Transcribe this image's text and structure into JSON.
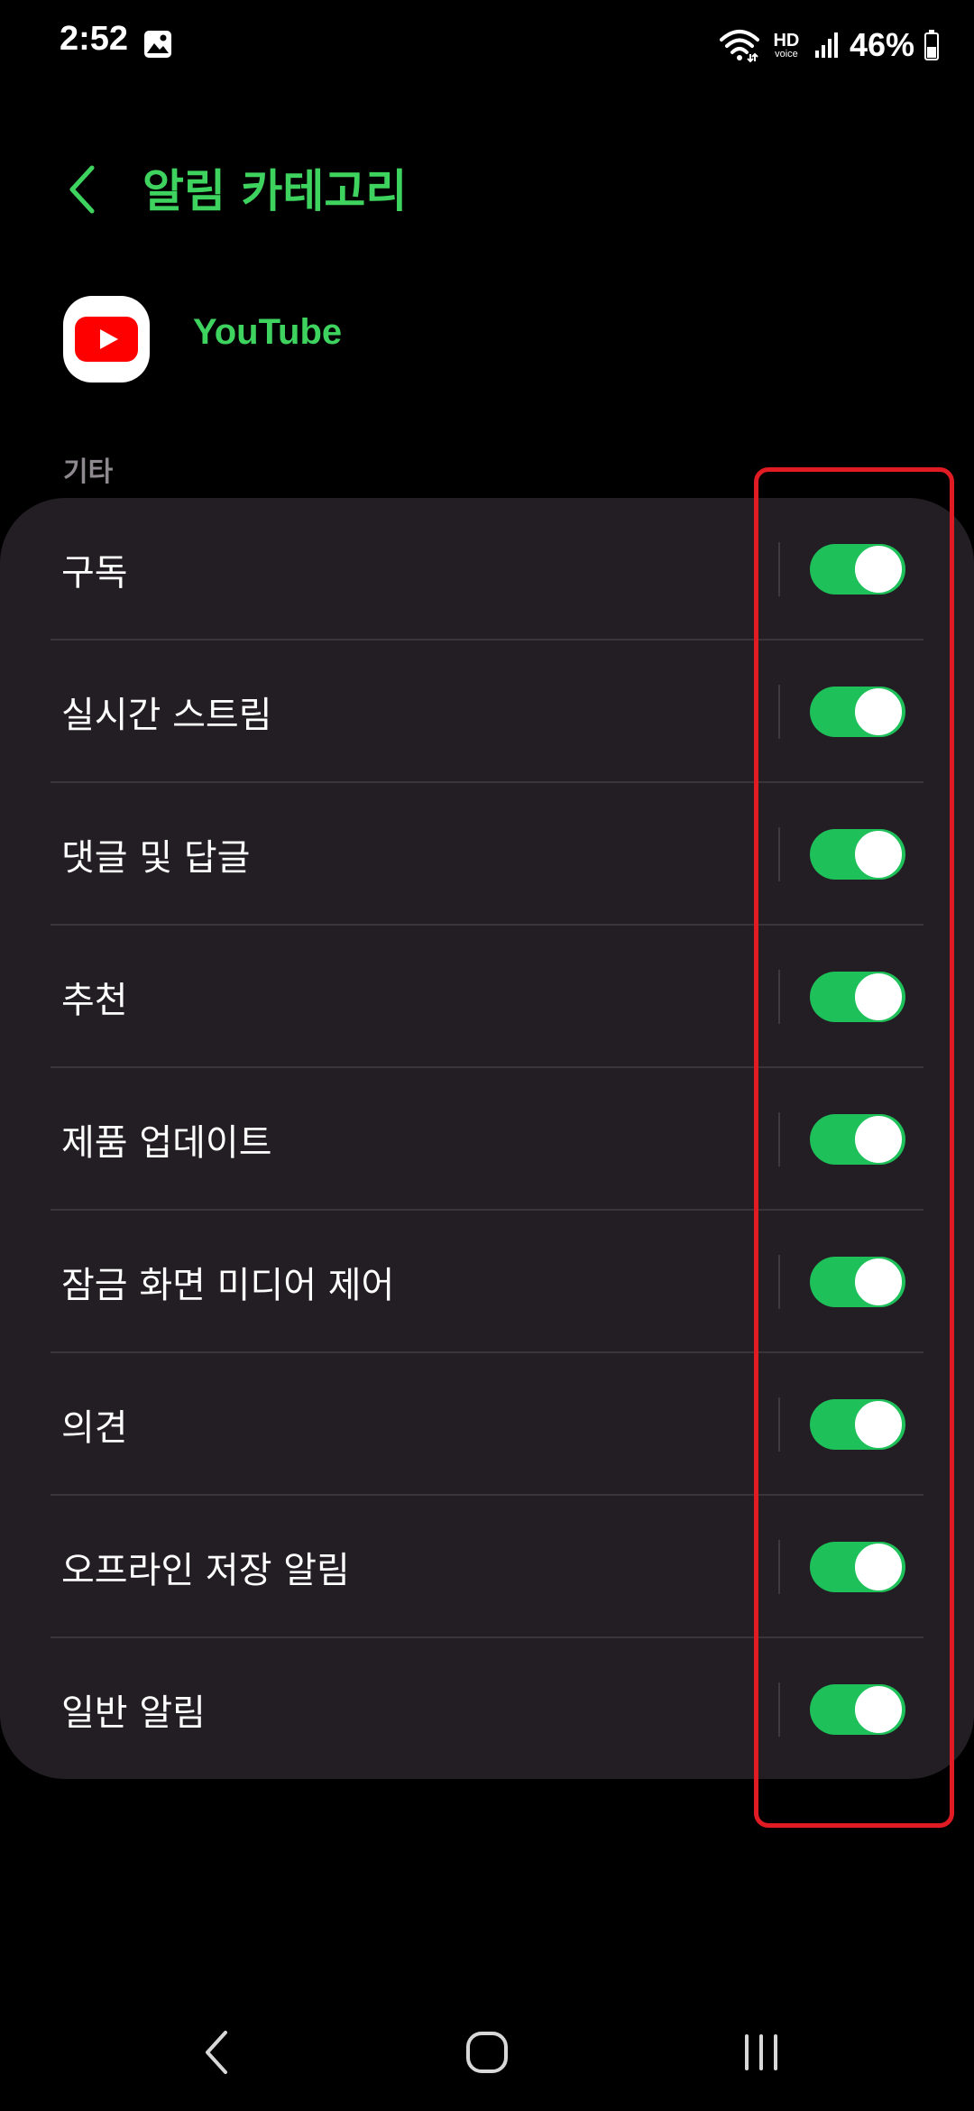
{
  "status_bar": {
    "time": "2:52",
    "hd_label": "HD",
    "voice_label": "voice",
    "battery": "46%"
  },
  "header": {
    "title": "알림 카테고리"
  },
  "app": {
    "name": "YouTube"
  },
  "section": {
    "label": "기타"
  },
  "settings": [
    {
      "label": "구독",
      "enabled": true
    },
    {
      "label": "실시간 스트림",
      "enabled": true
    },
    {
      "label": "댓글 및 답글",
      "enabled": true
    },
    {
      "label": "추천",
      "enabled": true
    },
    {
      "label": "제품 업데이트",
      "enabled": true
    },
    {
      "label": "잠금 화면 미디어 제어",
      "enabled": true
    },
    {
      "label": "의견",
      "enabled": true
    },
    {
      "label": "오프라인 저장 알림",
      "enabled": true
    },
    {
      "label": "일반 알림",
      "enabled": true
    }
  ],
  "colors": {
    "accent": "#3ed35f",
    "toggle_on": "#1ec05a",
    "card_bg": "#231e23",
    "highlight": "#e01b24"
  },
  "icons": {
    "back": "chevron-left-icon",
    "app": "youtube-logo-icon",
    "nav_back": "nav-back-icon",
    "nav_home": "nav-home-icon",
    "nav_recents": "nav-recents-icon"
  }
}
